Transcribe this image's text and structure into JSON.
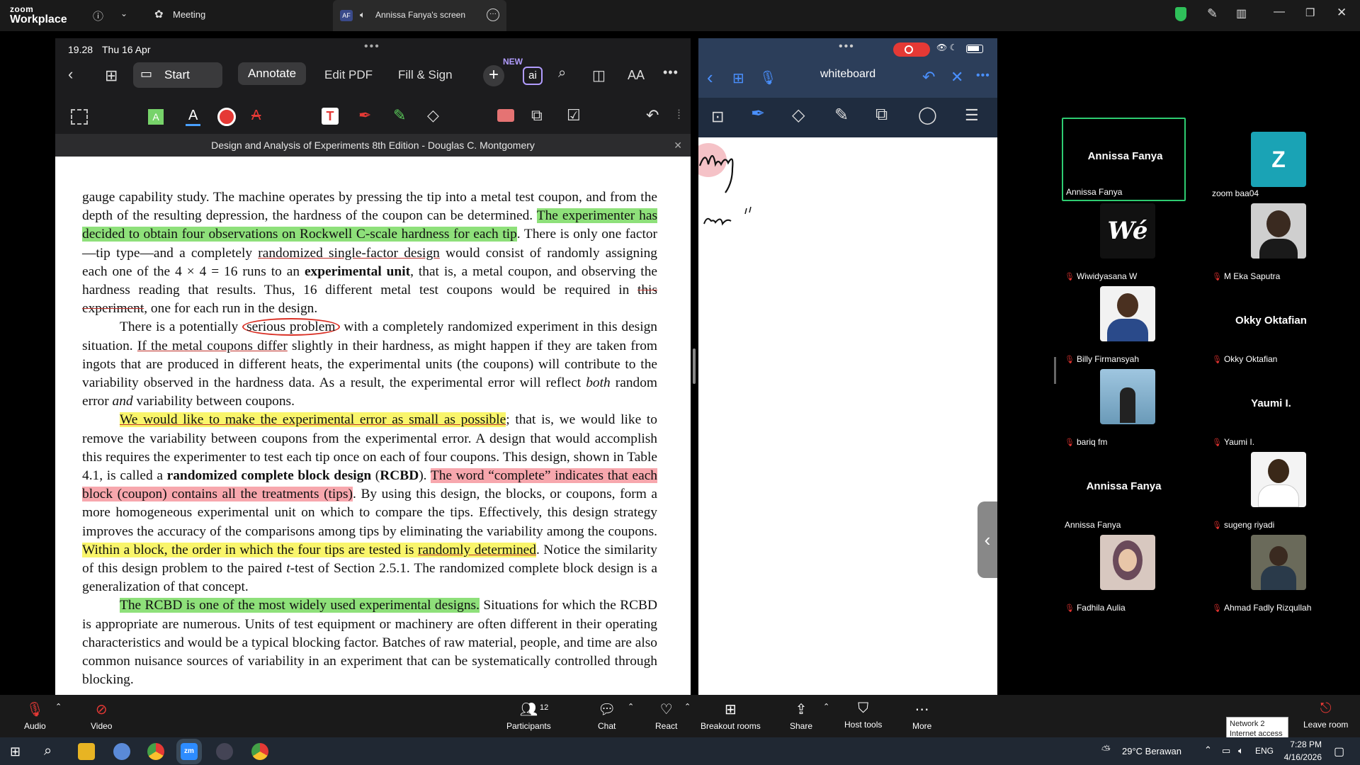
{
  "top": {
    "logo_small": "zoom",
    "logo_big": "Workplace",
    "meeting": "Meeting",
    "share_badge": "AF",
    "share_label": "Annissa Fanya's screen"
  },
  "ipad_left": {
    "time": "19.28",
    "date": "Thu 16 Apr",
    "tabs": [
      "Annotate",
      "Edit PDF",
      "Fill & Sign"
    ],
    "start": "Start",
    "new_badge": "NEW",
    "font_btn": "AA",
    "doc_title": "Design and Analysis of Experiments 8th Edition - Douglas C. Montgomery"
  },
  "doc": {
    "p1a": "gauge capability study. The machine operates by pressing the tip into a metal test coupon, and from the depth of the resulting depression, the hardness of the coupon can be determined. ",
    "p1b": "The experimenter has decided to obtain four observations on Rockwell C-scale hardness for each tip",
    "p1c": ". There is only one factor—tip type—and a completely ",
    "p1d": "randomized single-factor design",
    "p1e": " would consist of randomly assigning each one of the 4 × 4 = 16 runs to an ",
    "p1f": "experimental unit",
    "p1g": ", that is, a metal coupon, and observing the hardness reading that results. Thus, 16 different metal test coupons would be required in ",
    "p1h": "this experiment",
    "p1i": ", one for each run in the design.",
    "p2a": "There is a potentially ",
    "p2b": "serious problem",
    "p2c": " with a completely randomized experiment in this design situation. ",
    "p2d": "If the metal coupons differ",
    "p2e": " slightly in their hardness, as might happen if they are taken from ingots that are produced in different heats, the experimental units (the coupons) will contribute to the variability observed in the hardness data. As a result, the experimental error will reflect ",
    "p2f": "both",
    "p2g": " random error ",
    "p2h": "and",
    "p2i": " variability between coupons.",
    "p3a": "We would like to make the experimental error as small as possible",
    "p3b": "; that is, we would like to remove the variability between coupons from the experimental error. A design that would accomplish this requires the experimenter to test each tip once on each of four coupons. This design, shown in Table 4.1, is called a ",
    "p3c": "randomized complete block design",
    "p3d": " (",
    "p3e": "RCBD",
    "p3f": "). ",
    "p3g": "The word “complete” indicates that each block (coupon) contains all the treatments (tips)",
    "p3h": ". By using this design, the blocks, or coupons, form a more homogeneous experimental unit on which to compare the tips. Effectively, this design strategy improves the accuracy of the comparisons among tips by eliminating the variability among the coupons. ",
    "p3i": "Within a block, the order in which the four tips are tested is ",
    "p3j": "randomly determined",
    "p3k": ". Notice the similarity of this design problem to the paired ",
    "p3l": "t",
    "p3m": "-test of Section 2.5.1. The randomized complete block design is a generalization of that concept.",
    "p4a": "The RCBD is one of the most widely used experimental designs.",
    "p4b": " Situations for which the RCBD is appropriate are numerous. Units of test equipment or machinery are often different in their operating characteristics and would be a typical blocking factor. Batches of raw material, people, and time are also common nuisance sources of variability in an experiment that can be systematically controlled through blocking."
  },
  "whiteboard": {
    "title": "whiteboard"
  },
  "gallery": [
    {
      "name": "Annissa Fanya",
      "center": "Annissa Fanya",
      "muted": false,
      "active": true
    },
    {
      "name": "zoom baa04",
      "letter": "Z",
      "muted": false
    },
    {
      "name": "Wiwidyasana W",
      "muted": true
    },
    {
      "name": "M Eka Saputra",
      "muted": true
    },
    {
      "name": "Billy Firmansyah",
      "muted": true
    },
    {
      "name": "Okky Oktafian",
      "center": "Okky Oktafian",
      "muted": true
    },
    {
      "name": "bariq fm",
      "muted": true
    },
    {
      "name": "Yaumi I.",
      "center": "Yaumi I.",
      "muted": true
    },
    {
      "name": "Annissa Fanya",
      "center": "Annissa Fanya",
      "muted": false
    },
    {
      "name": "sugeng riyadi",
      "muted": true
    },
    {
      "name": "Fadhila Aulia",
      "muted": true
    },
    {
      "name": "Ahmad Fadly Rizqullah",
      "muted": true
    }
  ],
  "bottom": {
    "audio": "Audio",
    "video": "Video",
    "participants": "Participants",
    "participants_count": "12",
    "chat": "Chat",
    "react": "React",
    "breakout": "Breakout rooms",
    "share": "Share",
    "host_tools": "Host tools",
    "more": "More",
    "leave": "Leave room"
  },
  "tooltip": {
    "line1": "Network 2",
    "line2": "Internet access"
  },
  "taskbar": {
    "weather": "29°C  Berawan",
    "lang": "ENG",
    "time": "7:28 PM",
    "date": "4/16/2026"
  }
}
